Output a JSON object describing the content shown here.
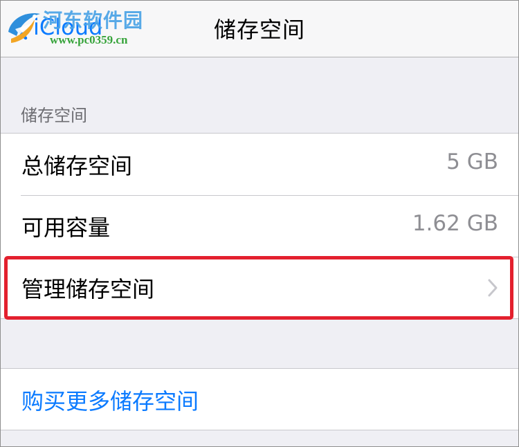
{
  "navbar": {
    "back_label": "iCloud",
    "title": "储存空间"
  },
  "watermark": {
    "site_name": "河东软件园",
    "url": "www.pc0359.cn"
  },
  "storage_section": {
    "header": "储存空间",
    "rows": [
      {
        "label": "总储存空间",
        "value": "5 GB"
      },
      {
        "label": "可用容量",
        "value": "1.62 GB"
      },
      {
        "label": "管理储存空间"
      }
    ]
  },
  "buy_more": {
    "label": "购买更多储存空间"
  },
  "colors": {
    "accent": "#0a7aff",
    "highlight": "#e3202e",
    "background": "#efeff4",
    "secondary_text": "#8e8e93"
  },
  "icons": {
    "back": "chevron-left-icon",
    "disclosure": "chevron-right-icon",
    "watermark_logo": "hedong-logo-icon"
  }
}
